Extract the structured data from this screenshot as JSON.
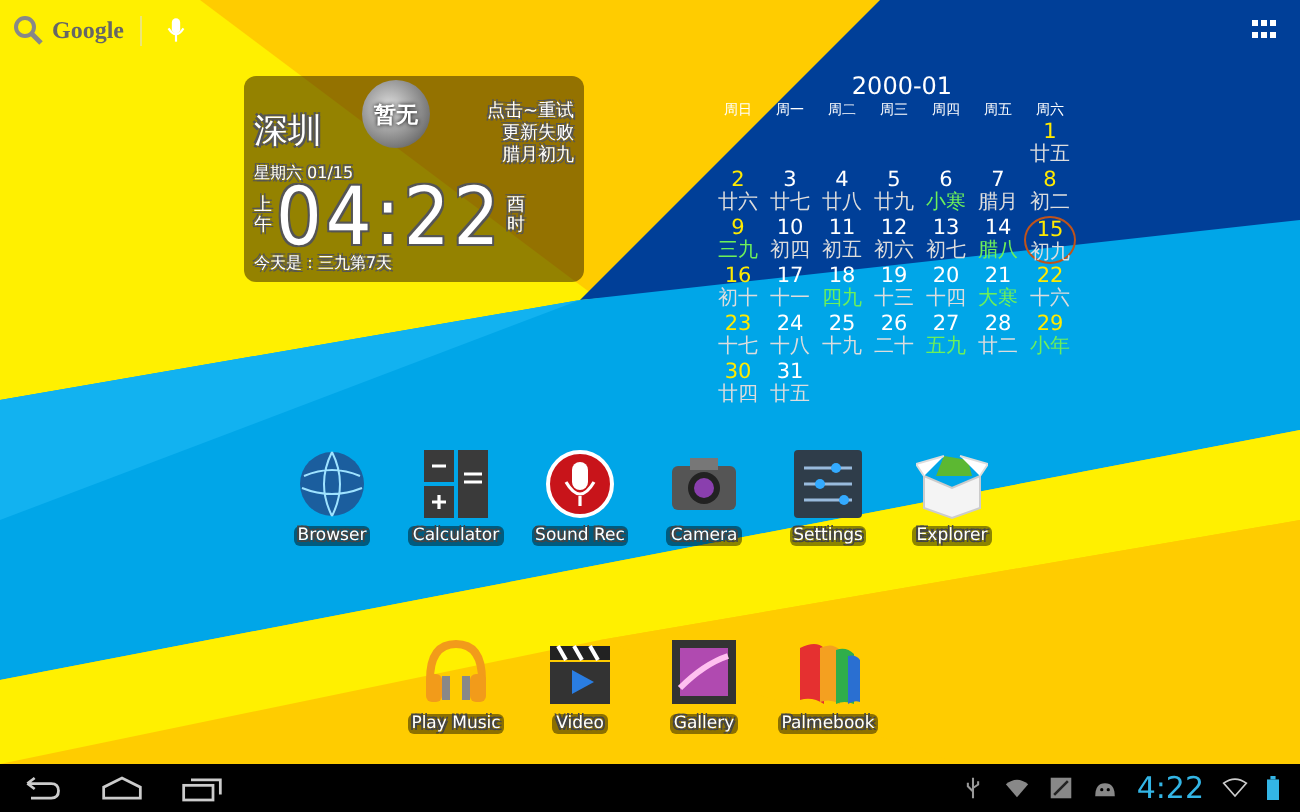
{
  "search_bar": {
    "label": "Google"
  },
  "clock_widget": {
    "city": "深圳",
    "weather": "暂无",
    "status_lines": [
      "点击~重试",
      "更新失败",
      "腊月初九"
    ],
    "date": "星期六 01/15",
    "period": "上午",
    "time": "04:22",
    "hour_name": "酉时",
    "note": "今天是：三九第7天"
  },
  "calendar": {
    "title": "2000-01",
    "weekdays": [
      "周日",
      "周一",
      "周二",
      "周三",
      "周四",
      "周五",
      "周六"
    ],
    "days": [
      {
        "day": "1",
        "lunar": "廿五",
        "festival": false,
        "selected": false
      },
      {
        "day": "2",
        "lunar": "廿六",
        "festival": false,
        "selected": false
      },
      {
        "day": "3",
        "lunar": "廿七",
        "festival": false,
        "selected": false
      },
      {
        "day": "4",
        "lunar": "廿八",
        "festival": false,
        "selected": false
      },
      {
        "day": "5",
        "lunar": "廿九",
        "festival": false,
        "selected": false
      },
      {
        "day": "6",
        "lunar": "小寒",
        "festival": true,
        "selected": false
      },
      {
        "day": "7",
        "lunar": "腊月",
        "festival": false,
        "selected": false
      },
      {
        "day": "8",
        "lunar": "初二",
        "festival": false,
        "selected": false
      },
      {
        "day": "9",
        "lunar": "三九",
        "festival": true,
        "selected": false
      },
      {
        "day": "10",
        "lunar": "初四",
        "festival": false,
        "selected": false
      },
      {
        "day": "11",
        "lunar": "初五",
        "festival": false,
        "selected": false
      },
      {
        "day": "12",
        "lunar": "初六",
        "festival": false,
        "selected": false
      },
      {
        "day": "13",
        "lunar": "初七",
        "festival": false,
        "selected": false
      },
      {
        "day": "14",
        "lunar": "腊八",
        "festival": true,
        "selected": false
      },
      {
        "day": "15",
        "lunar": "初九",
        "festival": false,
        "selected": true
      },
      {
        "day": "16",
        "lunar": "初十",
        "festival": false,
        "selected": false
      },
      {
        "day": "17",
        "lunar": "十一",
        "festival": false,
        "selected": false
      },
      {
        "day": "18",
        "lunar": "四九",
        "festival": true,
        "selected": false
      },
      {
        "day": "19",
        "lunar": "十三",
        "festival": false,
        "selected": false
      },
      {
        "day": "20",
        "lunar": "十四",
        "festival": false,
        "selected": false
      },
      {
        "day": "21",
        "lunar": "大寒",
        "festival": true,
        "selected": false
      },
      {
        "day": "22",
        "lunar": "十六",
        "festival": false,
        "selected": false
      },
      {
        "day": "23",
        "lunar": "十七",
        "festival": false,
        "selected": false
      },
      {
        "day": "24",
        "lunar": "十八",
        "festival": false,
        "selected": false
      },
      {
        "day": "25",
        "lunar": "十九",
        "festival": false,
        "selected": false
      },
      {
        "day": "26",
        "lunar": "二十",
        "festival": false,
        "selected": false
      },
      {
        "day": "27",
        "lunar": "五九",
        "festival": true,
        "selected": false
      },
      {
        "day": "28",
        "lunar": "廿二",
        "festival": false,
        "selected": false
      },
      {
        "day": "29",
        "lunar": "小年",
        "festival": true,
        "selected": false
      },
      {
        "day": "30",
        "lunar": "廿四",
        "festival": false,
        "selected": false
      },
      {
        "day": "31",
        "lunar": "廿五",
        "festival": false,
        "selected": false
      }
    ]
  },
  "apps_row_1": [
    {
      "kind": "globe",
      "label": "Browser"
    },
    {
      "kind": "calculator",
      "label": "Calculator"
    },
    {
      "kind": "microphone",
      "label": "Sound Rec"
    },
    {
      "kind": "camera",
      "label": "Camera"
    },
    {
      "kind": "sliders",
      "label": "Settings"
    },
    {
      "kind": "box",
      "label": "Explorer"
    }
  ],
  "apps_row_2": [
    {
      "kind": "headphones",
      "label": "Play Music"
    },
    {
      "kind": "clapper",
      "label": "Video"
    },
    {
      "kind": "picture",
      "label": "Gallery"
    },
    {
      "kind": "book",
      "label": "Palmebook"
    }
  ],
  "status_bar": {
    "time": "4:22"
  }
}
